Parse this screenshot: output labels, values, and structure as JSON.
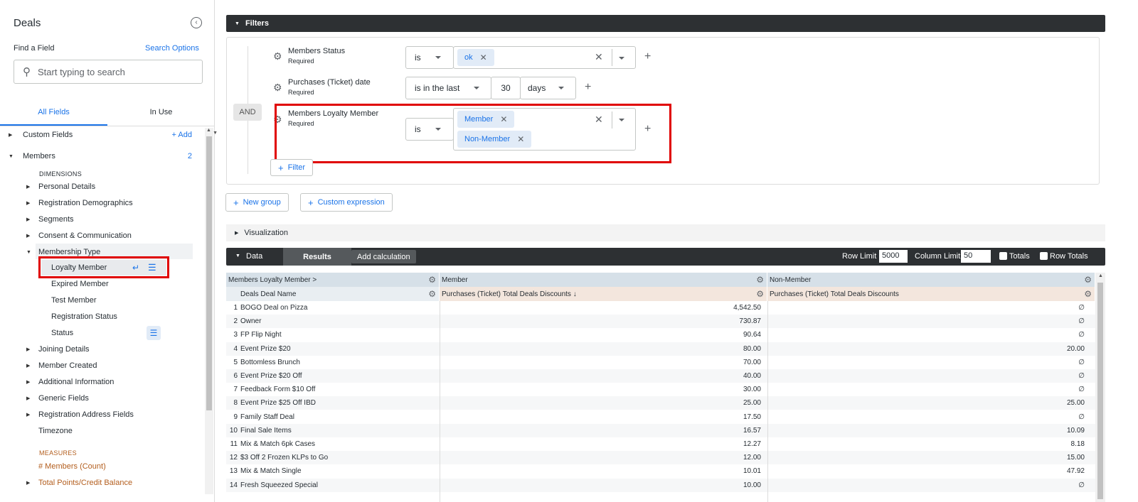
{
  "sidebar": {
    "title": "Deals",
    "find_label": "Find a Field",
    "search_options": "Search Options",
    "search_placeholder": "Start typing to search",
    "tabs": [
      {
        "label": "All Fields"
      },
      {
        "label": "In Use"
      }
    ],
    "custom_fields": "Custom Fields",
    "add_label": "+ Add",
    "members": "Members",
    "members_count": "2",
    "dimensions_label": "DIMENSIONS",
    "groups": [
      "Personal Details",
      "Registration Demographics",
      "Segments",
      "Consent & Communication",
      "Membership Type"
    ],
    "membership_items": [
      "Loyalty Member",
      "Expired Member",
      "Test Member",
      "Registration Status",
      "Status"
    ],
    "groups_after": [
      "Joining Details",
      "Member Created",
      "Additional Information",
      "Generic Fields",
      "Registration Address Fields"
    ],
    "timezone": "Timezone",
    "measures_label": "MEASURES",
    "measures": [
      "# Members (Count)",
      "Total Points/Credit Balance"
    ]
  },
  "filters": {
    "bar_label": "Filters",
    "and_label": "AND",
    "rows": [
      {
        "view": "Members",
        "field": "Status",
        "required": "Required",
        "operator": "is",
        "chips": [
          "ok"
        ]
      },
      {
        "view": "Purchases (Ticket)",
        "field": "date",
        "required": "Required",
        "operator": "is in the last",
        "amount": "30",
        "unit": "days"
      },
      {
        "view": "Members",
        "field": "Loyalty Member",
        "required": "Required",
        "operator": "is",
        "chips": [
          "Member",
          "Non-Member"
        ]
      }
    ],
    "add_filter": "Filter",
    "new_group": "New group",
    "custom_expression": "Custom expression"
  },
  "visualization": {
    "label": "Visualization"
  },
  "data": {
    "label": "Data",
    "results_tab": "Results",
    "add_calculation": "Add calculation",
    "row_limit_label": "Row Limit",
    "row_limit": "5000",
    "column_limit_label": "Column Limit",
    "column_limit": "50",
    "totals_label": "Totals",
    "row_totals_label": "Row Totals"
  },
  "table": {
    "pivot_header": {
      "view": "Members",
      "field": "Loyalty Member",
      "suffix": ">"
    },
    "pivot_values": [
      "Member",
      "Non-Member"
    ],
    "dim_header": {
      "view": "Deals",
      "field": "Deal Name"
    },
    "measure_header": {
      "view": "Purchases (Ticket)",
      "field": "Total Deals Discounts",
      "sort": "↓"
    },
    "measure_header2": {
      "view": "Purchases (Ticket)",
      "field": "Total Deals Discounts"
    },
    "rows": [
      {
        "n": "1",
        "name": "BOGO Deal on Pizza",
        "member": "4,542.50",
        "non_member": "∅"
      },
      {
        "n": "2",
        "name": "Owner",
        "member": "730.87",
        "non_member": "∅"
      },
      {
        "n": "3",
        "name": "FP Flip Night",
        "member": "90.64",
        "non_member": "∅"
      },
      {
        "n": "4",
        "name": "Event Prize $20",
        "member": "80.00",
        "non_member": "20.00"
      },
      {
        "n": "5",
        "name": "Bottomless Brunch",
        "member": "70.00",
        "non_member": "∅"
      },
      {
        "n": "6",
        "name": "Event Prize $20 Off",
        "member": "40.00",
        "non_member": "∅"
      },
      {
        "n": "7",
        "name": "Feedback Form $10 Off",
        "member": "30.00",
        "non_member": "∅"
      },
      {
        "n": "8",
        "name": "Event Prize $25 Off IBD",
        "member": "25.00",
        "non_member": "25.00"
      },
      {
        "n": "9",
        "name": "Family Staff Deal",
        "member": "17.50",
        "non_member": "∅"
      },
      {
        "n": "10",
        "name": "Final Sale Items",
        "member": "16.57",
        "non_member": "10.09"
      },
      {
        "n": "11",
        "name": "Mix & Match 6pk Cases",
        "member": "12.27",
        "non_member": "8.18"
      },
      {
        "n": "12",
        "name": "$3 Off 2 Frozen KLPs to Go",
        "member": "12.00",
        "non_member": "15.00"
      },
      {
        "n": "13",
        "name": "Mix & Match Single",
        "member": "10.01",
        "non_member": "47.92"
      },
      {
        "n": "14",
        "name": "Fresh Squeezed Special",
        "member": "10.00",
        "non_member": "∅"
      }
    ]
  },
  "colors": {
    "accent": "#1a73e8",
    "highlight": "#e00000",
    "dark_bar": "#2d3033",
    "measure_header_bg": "#f3e6dd",
    "pivot_header_bg": "#d6e0e8"
  }
}
